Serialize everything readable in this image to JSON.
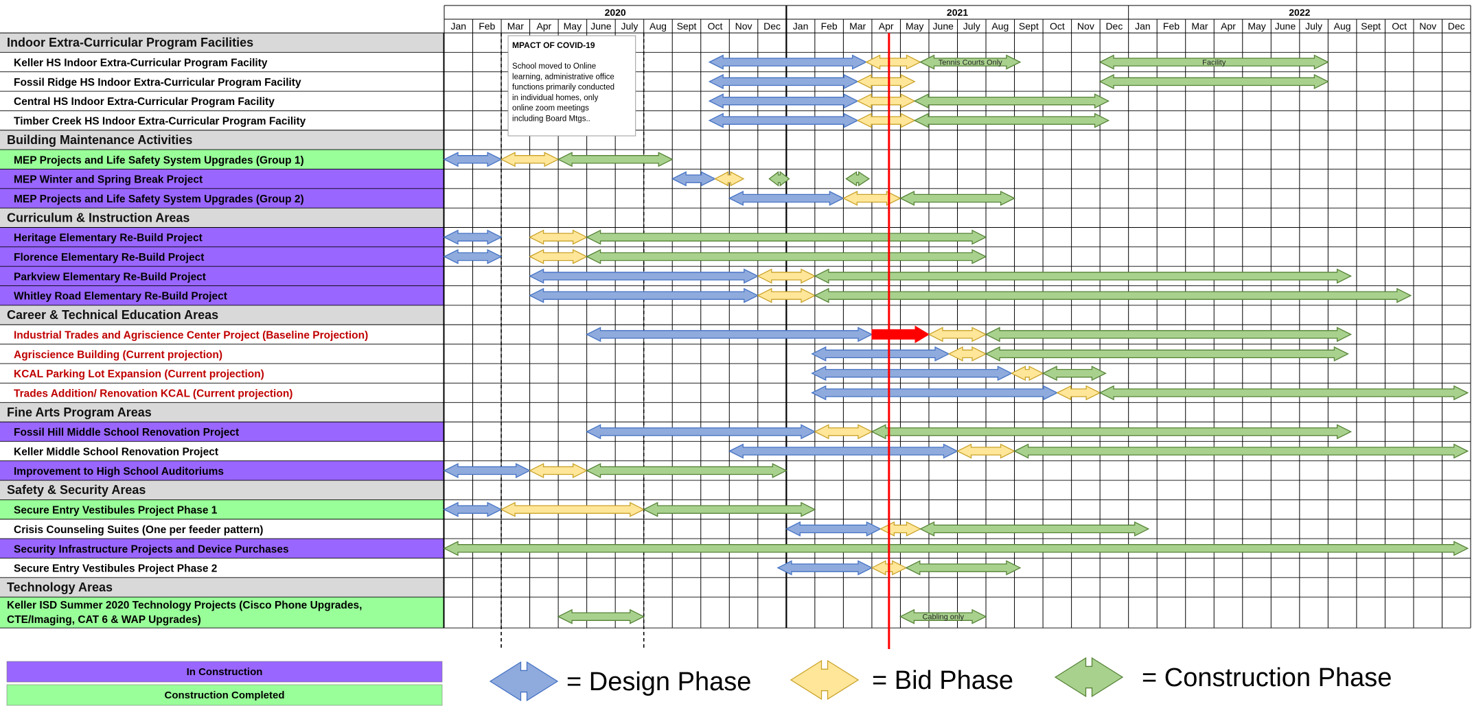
{
  "chart_data": {
    "type": "gantt",
    "years": [
      {
        "label": "2020",
        "start": 0,
        "months": 12
      },
      {
        "label": "2021",
        "start": 12,
        "months": 12
      },
      {
        "label": "2022",
        "start": 24,
        "months": 12
      }
    ],
    "months": [
      "Jan",
      "Feb",
      "Mar",
      "Apr",
      "May",
      "June",
      "July",
      "Aug",
      "Sept",
      "Oct",
      "Nov",
      "Dec",
      "Jan",
      "Feb",
      "Mar",
      "Apr",
      "May",
      "June",
      "July",
      "Aug",
      "Sept",
      "Oct",
      "Nov",
      "Dec",
      "Jan",
      "Feb",
      "Mar",
      "Apr",
      "May",
      "June",
      "July",
      "Aug",
      "Sept",
      "Oct",
      "Nov",
      "Dec"
    ],
    "current_marker_month": 15.6,
    "covid_note": {
      "title": "MPACT OF COVID-19",
      "lines": [
        "School moved to Online",
        "learning, administrative office",
        "functions primarily conducted",
        "in individual homes, only",
        "online zoom meetings",
        "including Board Mtgs.."
      ],
      "start": 2.0,
      "end": 7.0
    },
    "colors": {
      "design": "#8faadc",
      "design_stroke": "#4472c4",
      "bid": "#ffe699",
      "bid_stroke": "#c9a227",
      "construction": "#a9d18e",
      "construction_stroke": "#548235",
      "in_construction": "#9966ff",
      "completed": "#99ff99",
      "category_bg": "#d9d9d9",
      "red": "#ff0000",
      "red_text": "#c00000"
    },
    "rows": [
      {
        "type": "category",
        "label": "Indoor Extra-Curricular  Program Facilities"
      },
      {
        "label": "Keller HS Indoor Extra-Curricular Program Facility",
        "status": "none",
        "phases": [
          {
            "phase": "design",
            "start": 9.3,
            "end": 14.8
          },
          {
            "phase": "bid",
            "start": 14.8,
            "end": 16.7
          },
          {
            "phase": "construction",
            "start": 16.7,
            "end": 20.2,
            "label": "Tennis Courts Only"
          },
          {
            "phase": "construction",
            "start": 23.0,
            "end": 31.0,
            "label": "Facility"
          }
        ]
      },
      {
        "label": "Fossil Ridge HS Indoor Extra-Curricular Program Facility",
        "status": "none",
        "phases": [
          {
            "phase": "design",
            "start": 9.3,
            "end": 14.5
          },
          {
            "phase": "bid",
            "start": 14.5,
            "end": 16.5
          },
          {
            "phase": "construction",
            "start": 23.0,
            "end": 31.0
          }
        ]
      },
      {
        "label": "Central HS Indoor Extra-Curricular Program Facility",
        "status": "none",
        "phases": [
          {
            "phase": "design",
            "start": 9.3,
            "end": 14.5
          },
          {
            "phase": "bid",
            "start": 14.5,
            "end": 16.5
          },
          {
            "phase": "construction",
            "start": 16.5,
            "end": 23.3
          }
        ]
      },
      {
        "label": "Timber Creek HS Indoor Extra-Curricular Program Facility",
        "status": "none",
        "phases": [
          {
            "phase": "design",
            "start": 9.3,
            "end": 14.5
          },
          {
            "phase": "bid",
            "start": 14.5,
            "end": 16.5
          },
          {
            "phase": "construction",
            "start": 16.5,
            "end": 23.3
          }
        ]
      },
      {
        "type": "category",
        "label": "Building Maintenance Activities"
      },
      {
        "label": "MEP Projects and Life Safety System Upgrades (Group 1)",
        "status": "completed",
        "phases": [
          {
            "phase": "design",
            "start": 0.0,
            "end": 2.0
          },
          {
            "phase": "bid",
            "start": 2.0,
            "end": 4.0
          },
          {
            "phase": "construction",
            "start": 4.0,
            "end": 8.0
          }
        ]
      },
      {
        "label": "MEP Winter and Spring Break Project",
        "status": "in_construction",
        "phases": [
          {
            "phase": "design",
            "start": 8.0,
            "end": 9.5
          },
          {
            "phase": "bid",
            "start": 9.5,
            "end": 10.5
          },
          {
            "phase": "construction",
            "start": 11.4,
            "end": 12.1
          },
          {
            "phase": "construction",
            "start": 14.1,
            "end": 14.9
          }
        ]
      },
      {
        "label": "MEP Projects and Life Safety System Upgrades (Group 2)",
        "status": "in_construction",
        "phases": [
          {
            "phase": "design",
            "start": 10.0,
            "end": 14.0
          },
          {
            "phase": "bid",
            "start": 14.0,
            "end": 16.0
          },
          {
            "phase": "construction",
            "start": 16.0,
            "end": 20.0
          }
        ]
      },
      {
        "type": "category",
        "label": "Curriculum & Instruction Areas"
      },
      {
        "label": "Heritage Elementary Re-Build Project",
        "status": "in_construction",
        "phases": [
          {
            "phase": "design",
            "start": 0.0,
            "end": 2.0
          },
          {
            "phase": "bid",
            "start": 3.0,
            "end": 5.0
          },
          {
            "phase": "construction",
            "start": 5.0,
            "end": 19.0
          }
        ]
      },
      {
        "label": "Florence Elementary Re-Build Project",
        "status": "in_construction",
        "phases": [
          {
            "phase": "design",
            "start": 0.0,
            "end": 2.0
          },
          {
            "phase": "bid",
            "start": 3.0,
            "end": 5.0
          },
          {
            "phase": "construction",
            "start": 5.0,
            "end": 19.0
          }
        ]
      },
      {
        "label": "Parkview Elementary Re-Build Project",
        "status": "in_construction",
        "phases": [
          {
            "phase": "design",
            "start": 3.0,
            "end": 11.0
          },
          {
            "phase": "bid",
            "start": 11.0,
            "end": 13.0
          },
          {
            "phase": "construction",
            "start": 13.0,
            "end": 31.8
          }
        ]
      },
      {
        "label": "Whitley Road  Elementary Re-Build Project",
        "status": "in_construction",
        "phases": [
          {
            "phase": "design",
            "start": 3.0,
            "end": 11.0
          },
          {
            "phase": "bid",
            "start": 11.0,
            "end": 13.0
          },
          {
            "phase": "construction",
            "start": 13.0,
            "end": 33.9
          }
        ]
      },
      {
        "type": "category",
        "label": "Career & Technical Education Areas"
      },
      {
        "label": "Industrial Trades and Agriscience Center Project (Baseline Projection)",
        "status": "none",
        "text_color": "red",
        "phases": [
          {
            "phase": "design",
            "start": 5.0,
            "end": 15.0
          },
          {
            "phase": "delay",
            "start": 15.0,
            "end": 17.0
          },
          {
            "phase": "bid",
            "start": 17.0,
            "end": 19.0
          },
          {
            "phase": "construction",
            "start": 19.0,
            "end": 31.8
          }
        ]
      },
      {
        "label": "Agriscience Building (Current projection)",
        "status": "none",
        "text_color": "red",
        "phases": [
          {
            "phase": "design",
            "start": 12.9,
            "end": 17.7
          },
          {
            "phase": "bid",
            "start": 17.7,
            "end": 19.0
          },
          {
            "phase": "construction",
            "start": 19.0,
            "end": 31.7
          }
        ]
      },
      {
        "label": "KCAL Parking Lot Expansion (Current projection)",
        "status": "none",
        "text_color": "red",
        "phases": [
          {
            "phase": "design",
            "start": 12.9,
            "end": 19.9
          },
          {
            "phase": "bid",
            "start": 19.9,
            "end": 21.0
          },
          {
            "phase": "construction",
            "start": 21.0,
            "end": 23.2
          }
        ]
      },
      {
        "label": "Trades Addition/ Renovation KCAL (Current projection)",
        "status": "none",
        "text_color": "red",
        "phases": [
          {
            "phase": "design",
            "start": 12.9,
            "end": 21.5
          },
          {
            "phase": "bid",
            "start": 21.5,
            "end": 23.0
          },
          {
            "phase": "construction",
            "start": 23.0,
            "end": 35.9
          }
        ]
      },
      {
        "type": "category",
        "label": "Fine Arts Program Areas"
      },
      {
        "label": "Fossil Hill Middle School Renovation Project",
        "status": "in_construction",
        "phases": [
          {
            "phase": "design",
            "start": 5.0,
            "end": 13.0
          },
          {
            "phase": "bid",
            "start": 13.0,
            "end": 15.0
          },
          {
            "phase": "construction",
            "start": 15.0,
            "end": 31.8
          }
        ]
      },
      {
        "label": "Keller Middle School Renovation Project",
        "status": "none",
        "phases": [
          {
            "phase": "design",
            "start": 10.0,
            "end": 18.0
          },
          {
            "phase": "bid",
            "start": 18.0,
            "end": 20.0
          },
          {
            "phase": "construction",
            "start": 20.0,
            "end": 35.9
          }
        ]
      },
      {
        "label": "Improvement to High School Auditoriums",
        "status": "in_construction",
        "phases": [
          {
            "phase": "design",
            "start": 0.0,
            "end": 3.0
          },
          {
            "phase": "bid",
            "start": 3.0,
            "end": 5.0
          },
          {
            "phase": "construction",
            "start": 5.0,
            "end": 12.0
          }
        ]
      },
      {
        "type": "category",
        "label": "Safety & Security Areas"
      },
      {
        "label": "Secure Entry Vestibules Project Phase 1",
        "status": "completed",
        "phases": [
          {
            "phase": "design",
            "start": 0.0,
            "end": 2.0
          },
          {
            "phase": "bid",
            "start": 2.0,
            "end": 7.0
          },
          {
            "phase": "construction",
            "start": 7.0,
            "end": 13.0
          }
        ]
      },
      {
        "label": "Crisis Counseling Suites (One per feeder pattern)",
        "status": "none",
        "phases": [
          {
            "phase": "design",
            "start": 12.0,
            "end": 15.3
          },
          {
            "phase": "bid",
            "start": 15.3,
            "end": 16.7
          },
          {
            "phase": "construction",
            "start": 16.7,
            "end": 24.7
          }
        ]
      },
      {
        "label": "Security Infrastructure Projects and Device Purchases",
        "status": "in_construction",
        "phases": [
          {
            "phase": "construction",
            "start": 0.0,
            "end": 35.9
          }
        ]
      },
      {
        "label": "Secure Entry Vestibules Project Phase 2",
        "status": "none",
        "phases": [
          {
            "phase": "design",
            "start": 11.7,
            "end": 15.0
          },
          {
            "phase": "bid",
            "start": 15.0,
            "end": 16.2
          },
          {
            "phase": "construction",
            "start": 16.2,
            "end": 20.2
          }
        ]
      },
      {
        "type": "category",
        "label": "Technology Areas"
      },
      {
        "label": [
          "Keller ISD Summer 2020 Technology Projects (Cisco Phone Upgrades,",
          "CTE/Imaging, CAT 6 & WAP Upgrades)"
        ],
        "status": "completed",
        "tall": true,
        "phases": [
          {
            "phase": "construction",
            "start": 4.0,
            "end": 7.0
          },
          {
            "phase": "construction",
            "start": 16.0,
            "end": 19.0,
            "label": "Cabling only"
          }
        ]
      }
    ],
    "status_legend": [
      {
        "key": "in_construction",
        "label": "In Construction"
      },
      {
        "key": "completed",
        "label": "Construction Completed"
      }
    ],
    "phase_legend": [
      {
        "key": "design",
        "label": "= Design Phase"
      },
      {
        "key": "bid",
        "label": "= Bid Phase"
      },
      {
        "key": "construction",
        "label": "= Construction Phase"
      }
    ]
  }
}
